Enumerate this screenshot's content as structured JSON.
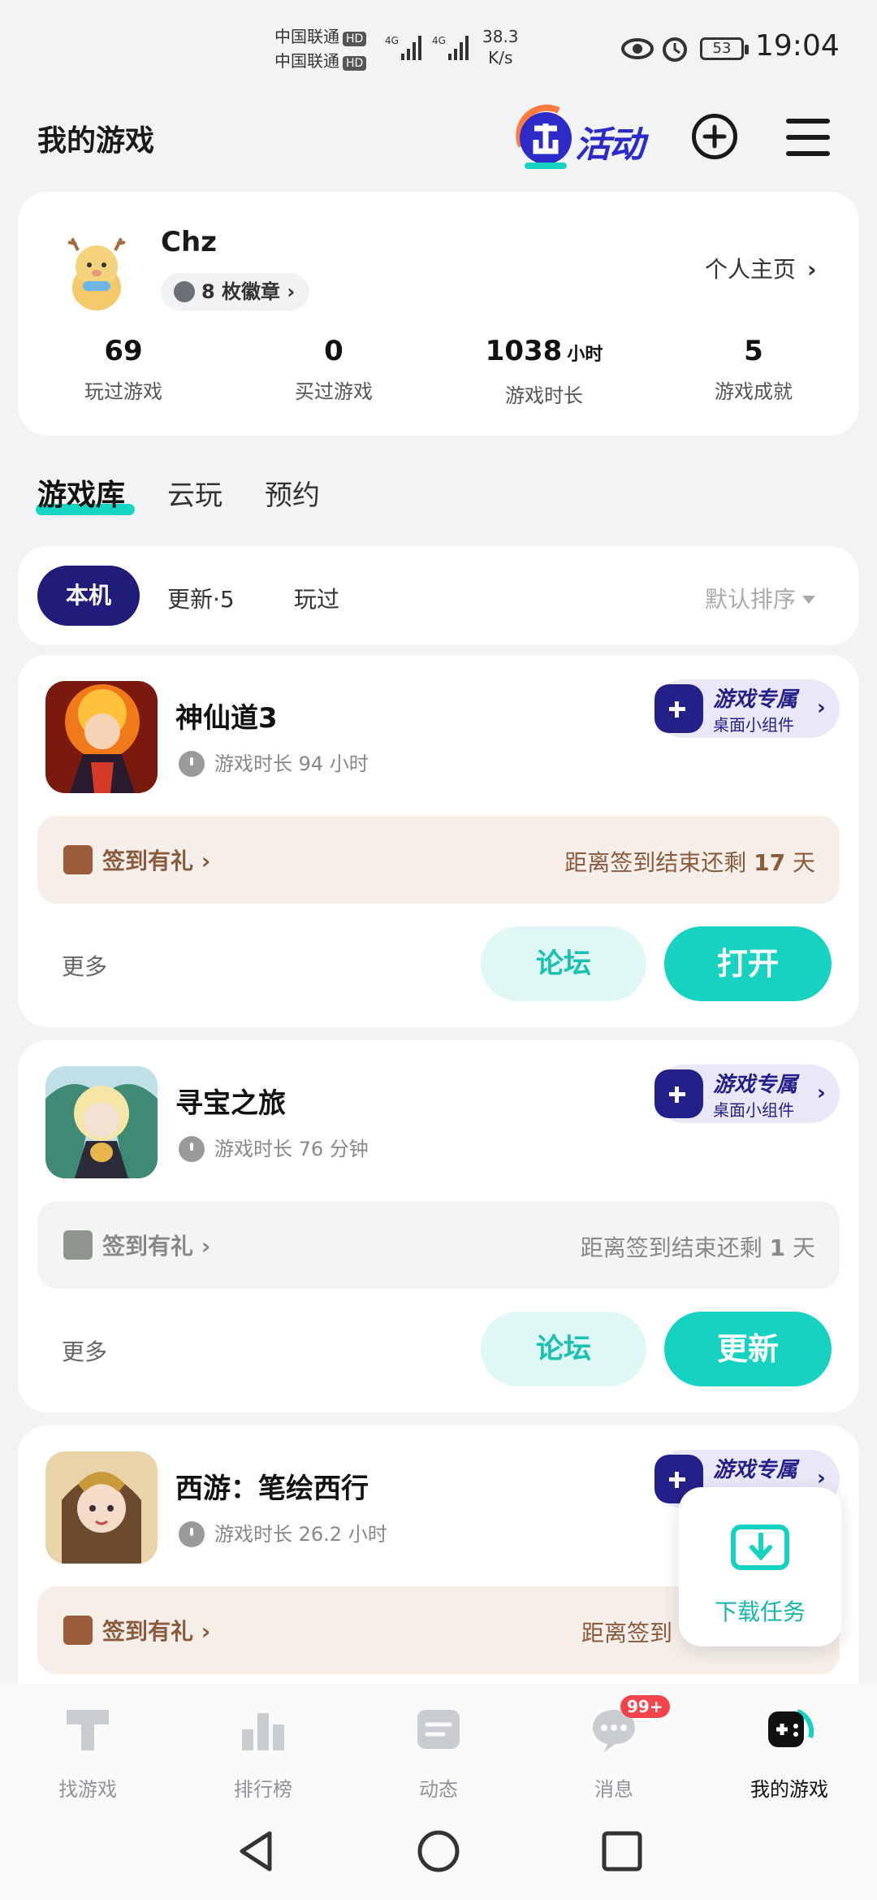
{
  "status_bar": {
    "carrier_1": "中国联通",
    "carrier_2": "中国联通",
    "hd": "HD",
    "net_1": "4G",
    "net_2": "4G",
    "speed_value": "38.3",
    "speed_unit": "K/s",
    "battery": "53",
    "time": "19:04"
  },
  "header": {
    "title": "我的游戏",
    "activity_label": "活动"
  },
  "profile": {
    "username": "Chz",
    "badges": "8 枚徽章",
    "homepage": "个人主页",
    "stats": [
      {
        "value": "69",
        "unit": "",
        "label": "玩过游戏"
      },
      {
        "value": "0",
        "unit": "",
        "label": "买过游戏"
      },
      {
        "value": "1038",
        "unit": "小时",
        "label": "游戏时长"
      },
      {
        "value": "5",
        "unit": "",
        "label": "游戏成就"
      }
    ]
  },
  "tabs": [
    "游戏库",
    "云玩",
    "预约"
  ],
  "filters": {
    "active": "本机",
    "update": "更新·5",
    "played": "玩过",
    "sort": "默认排序"
  },
  "games": [
    {
      "name": "神仙道3",
      "play_time": "游戏时长 94 小时",
      "widget_title": "游戏专属",
      "widget_sub": "桌面小组件",
      "signin_label": "签到有礼",
      "signin_prefix": "距离签到结束还剩 ",
      "signin_days": "17",
      "signin_suffix": " 天",
      "more": "更多",
      "forum": "论坛",
      "primary": "打开"
    },
    {
      "name": "寻宝之旅",
      "play_time": "游戏时长 76 分钟",
      "widget_title": "游戏专属",
      "widget_sub": "桌面小组件",
      "signin_label": "签到有礼",
      "signin_prefix": "距离签到结束还剩 ",
      "signin_days": "1",
      "signin_suffix": " 天",
      "more": "更多",
      "forum": "论坛",
      "primary": "更新"
    },
    {
      "name": "西游：笔绘西行",
      "play_time": "游戏时长 26.2 小时",
      "widget_title": "游戏专属",
      "signin_label": "签到有礼",
      "signin_prefix": "距离签到"
    }
  ],
  "download_task": "下载任务",
  "bottom_nav": [
    {
      "label": "找游戏"
    },
    {
      "label": "排行榜"
    },
    {
      "label": "动态"
    },
    {
      "label": "消息",
      "badge": "99+"
    },
    {
      "label": "我的游戏"
    }
  ],
  "colors": {
    "accent": "#15d3c0",
    "brand_dark": "#1f1c7a",
    "badge_red": "#f2444a",
    "signin_brown": "#8a5a3c"
  }
}
